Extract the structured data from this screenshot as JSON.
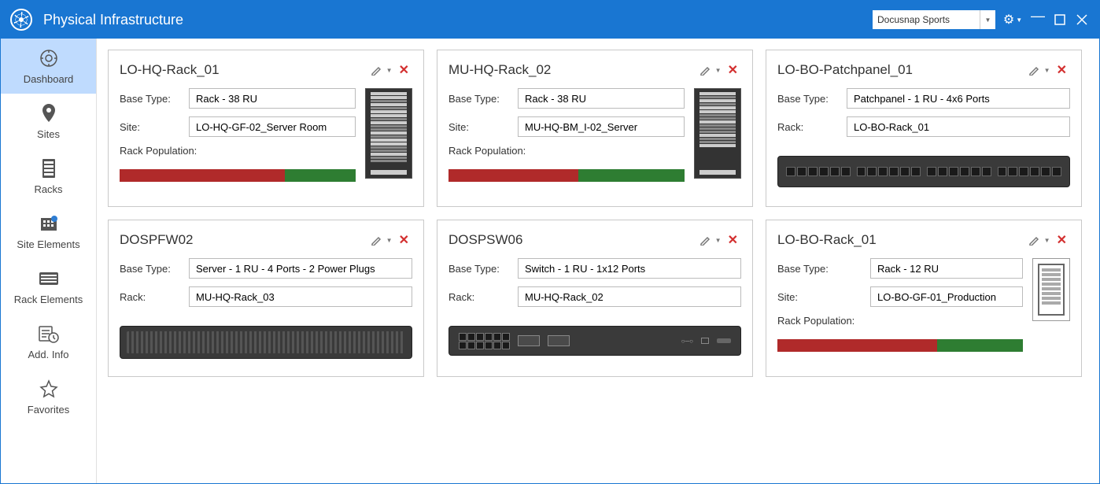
{
  "titlebar": {
    "title": "Physical Infrastructure",
    "tenant": "Docusnap Sports"
  },
  "sidebar": {
    "items": [
      {
        "label": "Dashboard"
      },
      {
        "label": "Sites"
      },
      {
        "label": "Racks"
      },
      {
        "label": "Site Elements"
      },
      {
        "label": "Rack Elements"
      },
      {
        "label": "Add. Info"
      },
      {
        "label": "Favorites"
      }
    ]
  },
  "labels": {
    "base_type": "Base Type:",
    "site": "Site:",
    "rack": "Rack:",
    "rack_population": "Rack Population:"
  },
  "cards": [
    {
      "title": "LO-HQ-Rack_01",
      "base_type": "Rack - 38 RU",
      "site": "LO-HQ-GF-02_Server Room",
      "population_red": 70,
      "population_green": 30,
      "visual": "rack"
    },
    {
      "title": "MU-HQ-Rack_02",
      "base_type": "Rack - 38 RU",
      "site": "MU-HQ-BM_I-02_Server",
      "population_red": 55,
      "population_green": 45,
      "visual": "rack"
    },
    {
      "title": "LO-BO-Patchpanel_01",
      "base_type": "Patchpanel - 1 RU - 4x6 Ports",
      "rack": "LO-BO-Rack_01",
      "visual": "patchpanel"
    },
    {
      "title": "DOSPFW02",
      "base_type": "Server - 1 RU - 4 Ports - 2 Power Plugs",
      "rack": "MU-HQ-Rack_03",
      "visual": "server"
    },
    {
      "title": "DOSPSW06",
      "base_type": "Switch - 1 RU - 1x12 Ports",
      "rack": "MU-HQ-Rack_02",
      "visual": "switch"
    },
    {
      "title": "LO-BO-Rack_01",
      "base_type": "Rack - 12 RU",
      "site": "LO-BO-GF-01_Production",
      "population_red": 65,
      "population_green": 35,
      "visual": "small-rack"
    }
  ]
}
